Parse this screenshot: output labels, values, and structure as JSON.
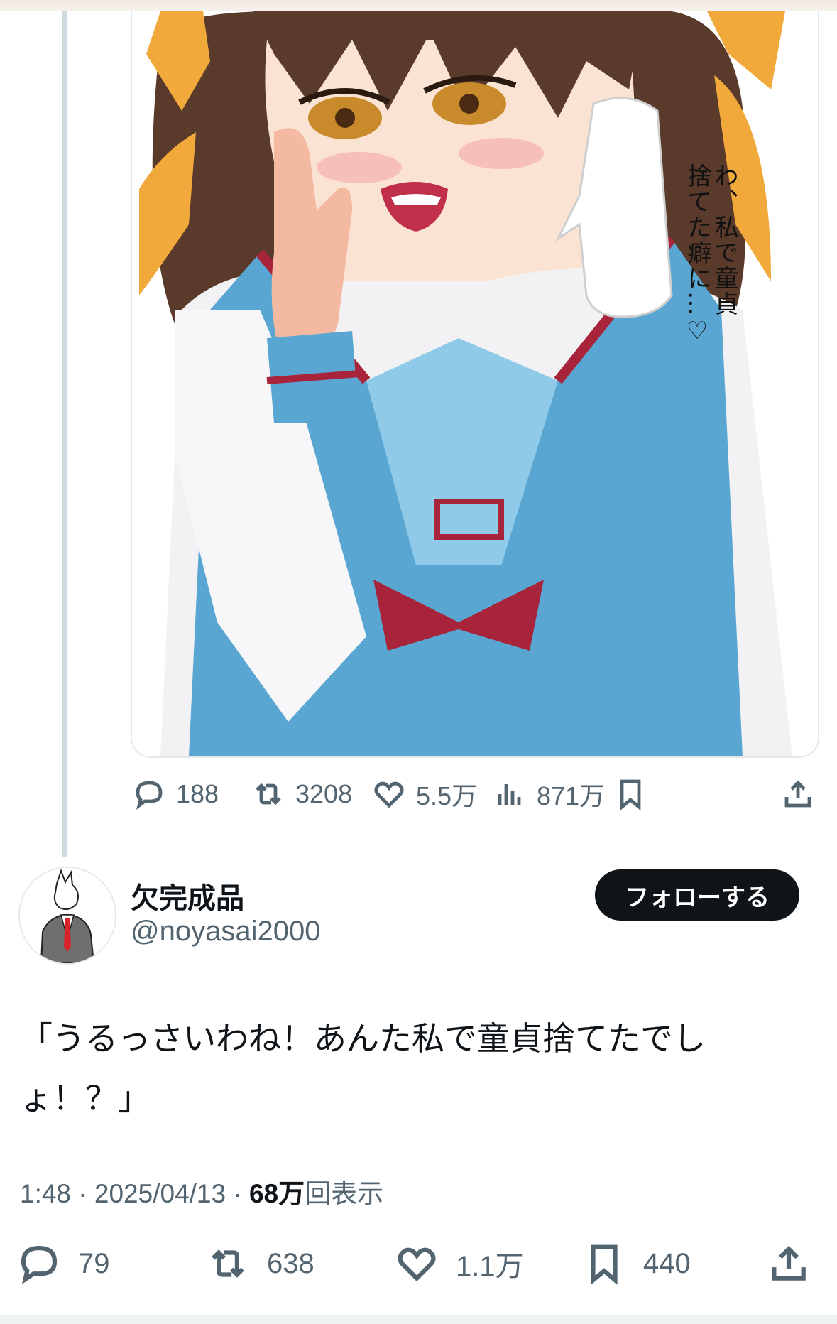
{
  "quoted_post": {
    "image": {
      "alt_subject": "anime-illustration",
      "speech_bubble_lines": [
        "わ、私で童貞",
        "捨てた癖に…♡"
      ]
    },
    "actions": {
      "reply_count": "188",
      "repost_count": "3208",
      "like_count": "5.5万",
      "view_count": "871万"
    }
  },
  "author": {
    "display_name": "欠完成品",
    "handle": "@noyasai2000",
    "follow_label": "フォローする"
  },
  "post": {
    "text": "「うるっさいわね！あんた私で童貞捨てたでしょ！？」",
    "time": "1:48",
    "separator": "·",
    "date": "2025/04/13",
    "views_count": "68万",
    "views_label": "回表示"
  },
  "actions": {
    "reply_count": "79",
    "repost_count": "638",
    "like_count": "1.1万",
    "bookmark_count": "440"
  },
  "colors": {
    "text_primary": "#0f1419",
    "text_secondary": "#536471",
    "follow_button_bg": "#0f1419",
    "thread_line": "#cfd9de",
    "uniform_blue": "#5aa6d2",
    "ribbon_red": "#a8243a",
    "ribbon_orange": "#f0a93a",
    "hair_brown": "#5a3a2a"
  },
  "icons": [
    "reply-icon",
    "repost-icon",
    "like-icon",
    "views-icon",
    "bookmark-icon",
    "share-icon"
  ]
}
